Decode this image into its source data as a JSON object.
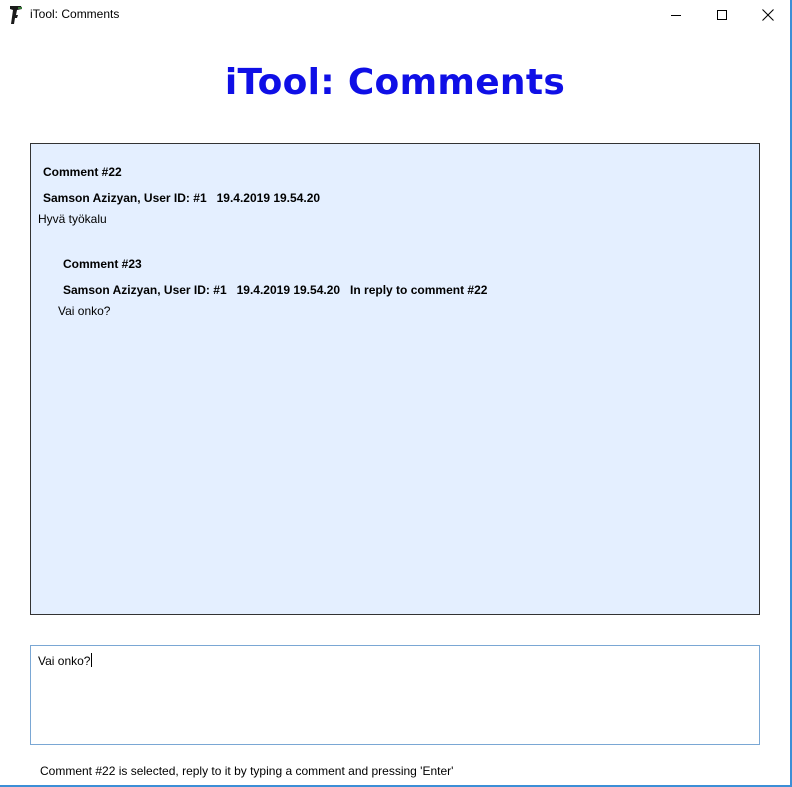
{
  "window": {
    "title": "iTool: Comments",
    "icon": "drill-icon"
  },
  "heading": "iTool: Comments",
  "comments": [
    {
      "title": "Comment #22",
      "meta": "Samson Azizyan, User ID: #1   19.4.2019 19.54.20",
      "body": "Hyvä työkalu"
    },
    {
      "title": "Comment #23",
      "meta": "Samson Azizyan, User ID: #1   19.4.2019 19.54.20   In reply to comment #22",
      "body": "Vai onko?"
    }
  ],
  "input": {
    "value": "Vai onko?"
  },
  "status": "Comment #22 is selected, reply to it by typing a comment and pressing 'Enter'",
  "colors": {
    "heading": "#0f0fe6",
    "panel_bg": "#e4efff",
    "window_border": "#3c8fd6"
  }
}
